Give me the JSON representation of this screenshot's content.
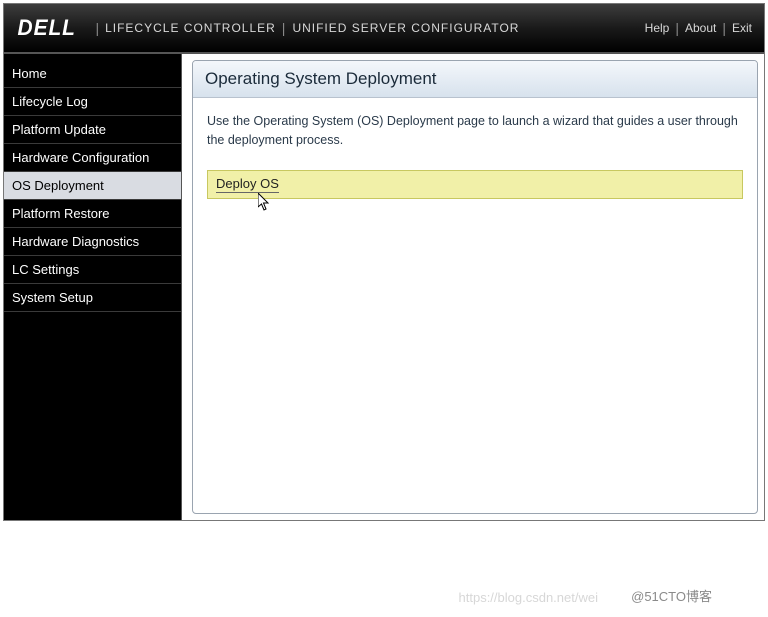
{
  "header": {
    "logo": "DELL",
    "title1": "LIFECYCLE CONTROLLER",
    "title2": "UNIFIED SERVER CONFIGURATOR",
    "help": "Help",
    "about": "About",
    "exit": "Exit"
  },
  "sidebar": {
    "items": [
      {
        "label": "Home",
        "active": false
      },
      {
        "label": "Lifecycle Log",
        "active": false
      },
      {
        "label": "Platform Update",
        "active": false
      },
      {
        "label": "Hardware Configuration",
        "active": false
      },
      {
        "label": "OS Deployment",
        "active": true
      },
      {
        "label": "Platform Restore",
        "active": false
      },
      {
        "label": "Hardware Diagnostics",
        "active": false
      },
      {
        "label": "LC Settings",
        "active": false
      },
      {
        "label": "System Setup",
        "active": false
      }
    ]
  },
  "main": {
    "title": "Operating System Deployment",
    "description": "Use the Operating System (OS) Deployment page to launch a wizard that guides a user through the deployment process.",
    "deploy_label": "Deploy OS"
  },
  "watermark": {
    "w1": "https://blog.csdn.net/wei",
    "w2": "@51CTO博客"
  }
}
